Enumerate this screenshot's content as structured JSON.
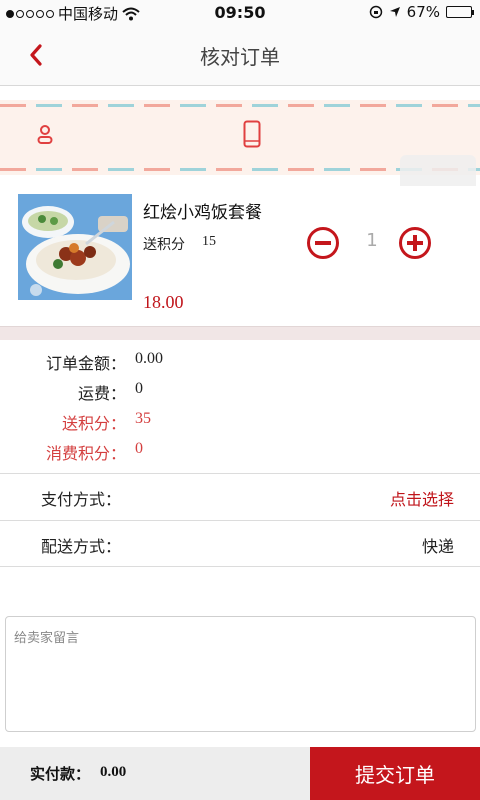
{
  "status_bar": {
    "carrier": "中国移动",
    "time": "09:50",
    "battery": "67%",
    "battery_level": 0.67,
    "signal_bars": 1
  },
  "nav": {
    "title": "核对订单",
    "back_icon": "chevron-left-icon"
  },
  "address": {
    "person_icon": "person-icon",
    "phone_icon": "phone-icon"
  },
  "product": {
    "name": "红烩小鸡饭套餐",
    "points_label": "送积分",
    "points_value": "15",
    "price": "18.00",
    "quantity": "1"
  },
  "summary": {
    "order_amount_label": "订单金额：",
    "order_amount_value": "0.00",
    "shipping_label": "运费：",
    "shipping_value": "0",
    "bonus_points_label": "送积分：",
    "bonus_points_value": "35",
    "spend_points_label": "消费积分：",
    "spend_points_value": "0"
  },
  "payment": {
    "label": "支付方式：",
    "value": "点击选择"
  },
  "delivery": {
    "label": "配送方式：",
    "value": "快递"
  },
  "message": {
    "placeholder": "给卖家留言"
  },
  "footer": {
    "pay_label": "实付款：",
    "pay_value": "0.00",
    "submit_label": "提交订单"
  },
  "colors": {
    "accent_red": "#c4161c",
    "text_red": "#d43f3f",
    "stripe_pink": "#f2a89c",
    "stripe_blue": "#9fd3da"
  }
}
